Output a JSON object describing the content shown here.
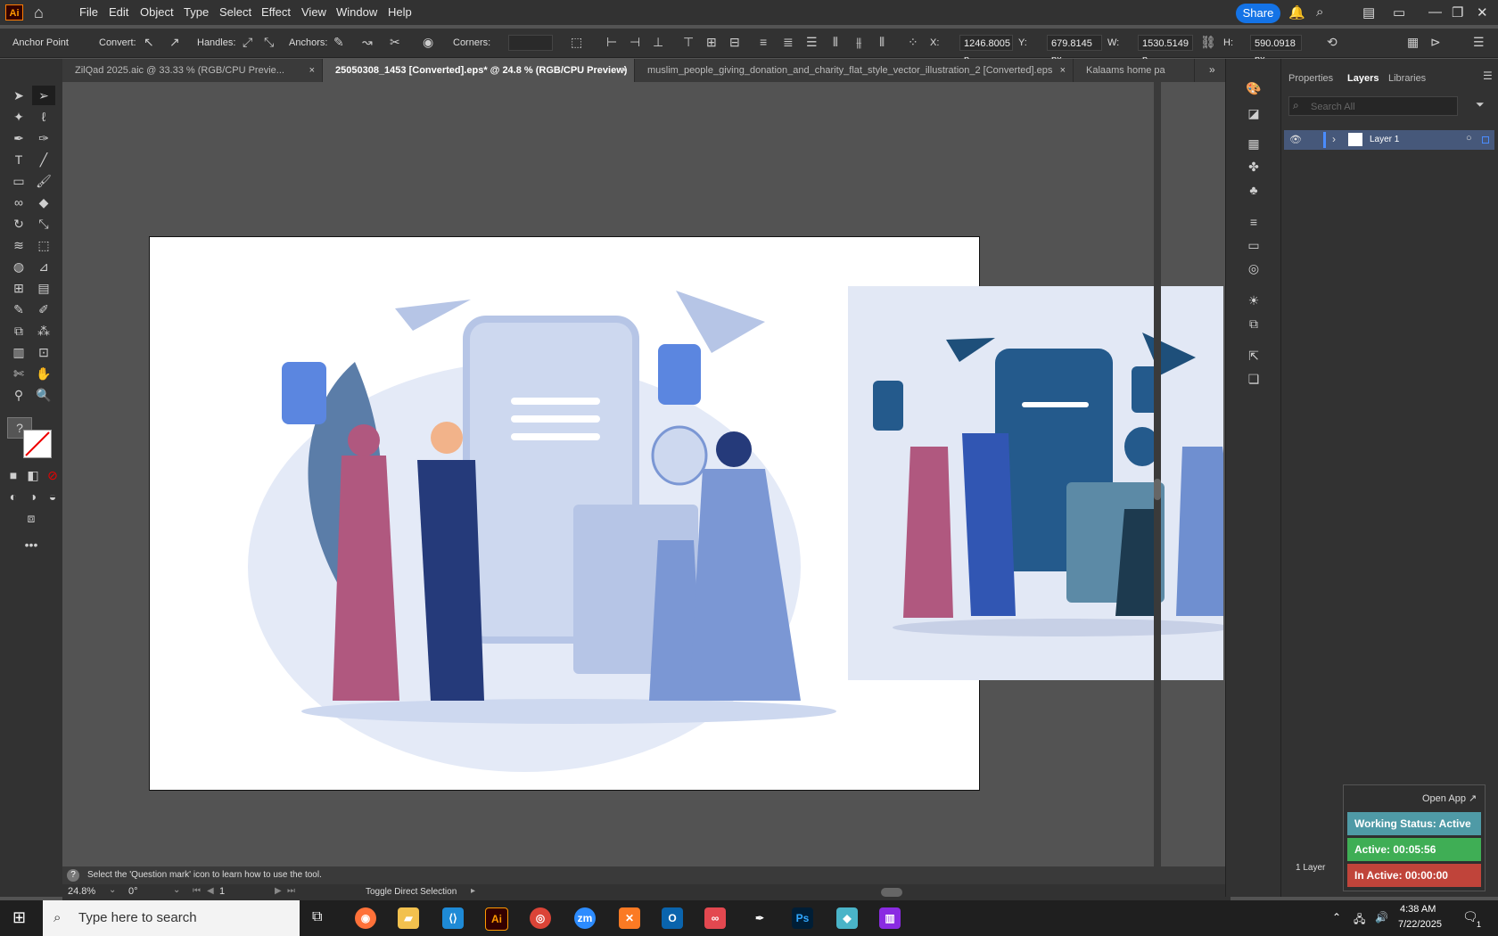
{
  "app": {
    "logo": "Ai",
    "menu": [
      "File",
      "Edit",
      "Object",
      "Type",
      "Select",
      "Effect",
      "View",
      "Window",
      "Help"
    ],
    "share_label": "Share"
  },
  "control_bar": {
    "tool_name": "Anchor Point",
    "convert_label": "Convert:",
    "handles_label": "Handles:",
    "anchors_label": "Anchors:",
    "corners_label": "Corners:",
    "x_label": "X:",
    "x_value": "1246.8005 p",
    "y_label": "Y:",
    "y_value": "679.8145 px",
    "w_label": "W:",
    "w_value": "1530.5149 p",
    "h_label": "H:",
    "h_value": "590.0918 px"
  },
  "tabs": [
    {
      "label": "ZilQad 2025.aic @ 33.33 % (RGB/CPU Previe...",
      "active": false
    },
    {
      "label": "25050308_1453 [Converted].eps* @ 24.8 % (RGB/CPU Preview)",
      "active": true
    },
    {
      "label": "muslim_people_giving_donation_and_charity_flat_style_vector_illustration_2 [Converted].eps",
      "active": false
    },
    {
      "label": "Kalaams home pa",
      "active": false
    }
  ],
  "status": {
    "hint": "Select the 'Question mark' icon to learn how to use the tool.",
    "zoom": "24.8%",
    "rotation": "0°",
    "artboard": "1",
    "mode": "Toggle Direct Selection"
  },
  "panel": {
    "tabs": [
      "Properties",
      "Layers",
      "Libraries"
    ],
    "active_tab": "Layers",
    "search_placeholder": "Search All",
    "layers": [
      {
        "name": "Layer 1"
      }
    ],
    "layer_count": "1 Layer"
  },
  "widget": {
    "open_app": "Open App ↗",
    "working_status": "Working Status: Active",
    "active_time": "Active: 00:05:56",
    "inactive_time": "In Active: 00:00:00",
    "colors": {
      "status": "#4f9aa6",
      "active": "#3fae55",
      "inactive": "#c0443a"
    }
  },
  "taskbar": {
    "search_placeholder": "Type here to search",
    "apps": [
      "Firefox",
      "Files",
      "VS Code",
      "Illustrator",
      "Chrome",
      "Zoom",
      "XAMPP",
      "Outlook",
      "Creative Cloud",
      "Pen tool",
      "Photoshop",
      "Chat",
      "WinRAR"
    ],
    "time": "4:38 AM",
    "date": "7/22/2025",
    "notifications": "1"
  },
  "colors": {
    "accent": "#1473e6",
    "art_light": "#cdd8ef",
    "art_mid": "#7b97d4",
    "art_pink": "#b0587f",
    "art_navy": "#253a7a",
    "art_teal": "#2f5f8a"
  }
}
